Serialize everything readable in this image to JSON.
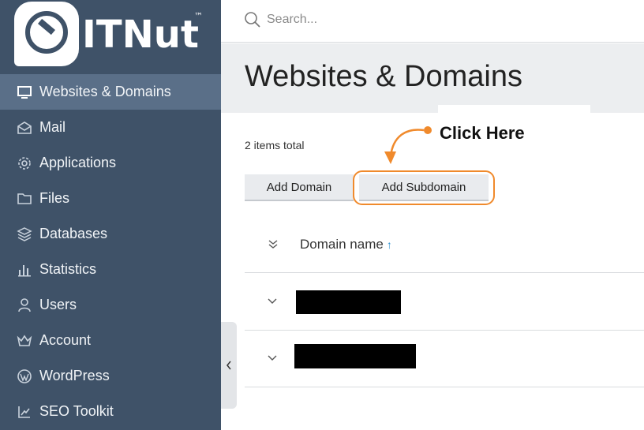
{
  "brand": {
    "name": "ITNut",
    "trademark": "™"
  },
  "search": {
    "placeholder": "Search..."
  },
  "sidebar": {
    "items": [
      {
        "label": "Websites & Domains",
        "icon": "monitor-icon",
        "active": true
      },
      {
        "label": "Mail",
        "icon": "envelope-icon"
      },
      {
        "label": "Applications",
        "icon": "gear-icon"
      },
      {
        "label": "Files",
        "icon": "folder-icon"
      },
      {
        "label": "Databases",
        "icon": "layers-icon"
      },
      {
        "label": "Statistics",
        "icon": "bar-chart-icon"
      },
      {
        "label": "Users",
        "icon": "user-icon"
      },
      {
        "label": "Account",
        "icon": "crown-icon"
      },
      {
        "label": "WordPress",
        "icon": "wordpress-icon"
      },
      {
        "label": "SEO Toolkit",
        "icon": "seo-icon"
      }
    ]
  },
  "main": {
    "title": "Websites & Domains",
    "items_total": "2 items total",
    "buttons": {
      "add_domain": "Add Domain",
      "add_subdomain": "Add Subdomain"
    },
    "annotation": "Click Here",
    "table": {
      "column_header": "Domain name",
      "sort_indicator": "↑"
    }
  },
  "colors": {
    "sidebar": "#3f5268",
    "sidebar_active": "#5a6f88",
    "highlight": "#f08a2c",
    "sort_arrow": "#2a8fd0"
  }
}
